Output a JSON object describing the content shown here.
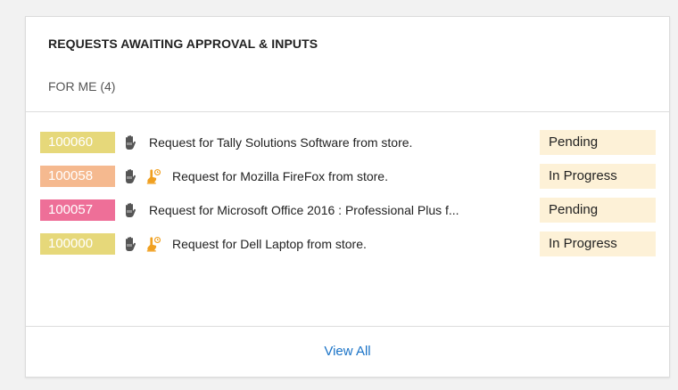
{
  "widget": {
    "title": "REQUESTS AWAITING APPROVAL & INPUTS",
    "filter_label": "FOR ME (4)",
    "view_all_label": "View All"
  },
  "requests": [
    {
      "id": "100060",
      "id_color": "#e6d87a",
      "has_approval_icon": false,
      "subject": "Request for Tally Solutions Software from store.",
      "status": "Pending"
    },
    {
      "id": "100058",
      "id_color": "#f5b98f",
      "has_approval_icon": true,
      "subject": "Request for Mozilla FireFox from store.",
      "status": "In Progress"
    },
    {
      "id": "100057",
      "id_color": "#ee6f98",
      "has_approval_icon": false,
      "subject": "Request for Microsoft Office 2016 : Professional Plus f...",
      "status": "Pending"
    },
    {
      "id": "100000",
      "id_color": "#e6d87a",
      "has_approval_icon": true,
      "subject": "Request for Dell Laptop from store.",
      "status": "In Progress"
    }
  ],
  "colors": {
    "status_background": "#fdf1d7",
    "link": "#1a73c7",
    "approval_icon": "#f0a020",
    "hand_icon": "#555555"
  },
  "icons": {
    "hand": "hand-icon",
    "approval": "approval-clock-icon"
  }
}
